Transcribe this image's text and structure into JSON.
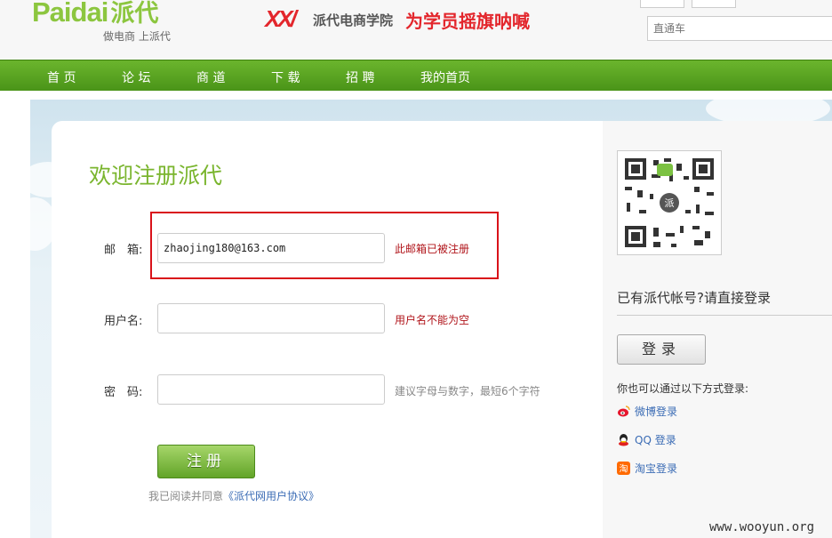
{
  "header": {
    "logo_latin": "Paidai",
    "logo_cn": "派代",
    "slogan": "做电商 上派代",
    "banner_mark": "XX/",
    "banner_name": "派代电商学院",
    "banner_tag": "为学员摇旗呐喊",
    "search_placeholder": "直通车"
  },
  "nav": {
    "items": [
      "首 页",
      "论 坛",
      "商 道",
      "下 载",
      "招 聘",
      "我的首页"
    ]
  },
  "form": {
    "title": "欢迎注册派代",
    "email_label": "邮　箱:",
    "email_value": "zhaojing180@163.com",
    "email_msg": "此邮箱已被注册",
    "username_label": "用户名:",
    "username_value": "",
    "username_msg": "用户名不能为空",
    "password_label": "密　码:",
    "password_value": "",
    "password_msg": "建议字母与数字，最短6个字符",
    "submit_label": "注册",
    "agree_text": "我已阅读并同意",
    "agree_link": "《派代网用户协议》"
  },
  "side": {
    "login_question": "已有派代帐号?请直接登录",
    "login_button": "登录",
    "alt_login_text": "你也可以通过以下方式登录:",
    "weibo_label": "微博登录",
    "qq_label": "QQ 登录",
    "taobao_label": "淘宝登录"
  },
  "watermark": "www.wooyun.org",
  "colors": {
    "brand_green": "#8cc63f",
    "nav_green": "#4a9418",
    "error_red": "#b0141a",
    "highlight_red": "#d9121a"
  }
}
